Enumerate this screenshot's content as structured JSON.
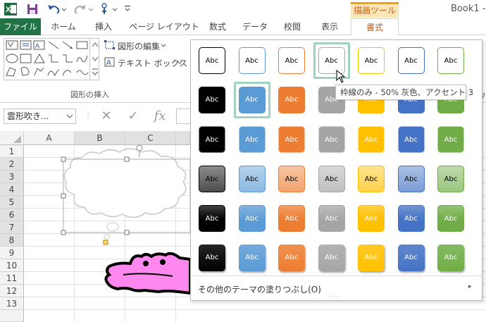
{
  "app": {
    "title": "Book1 -",
    "context_tab": "描画ツール"
  },
  "tabs": [
    "ファイル",
    "ホーム",
    "挿入",
    "ページ レイアウト",
    "数式",
    "データ",
    "校閲",
    "表示",
    "書式"
  ],
  "ribbon": {
    "edit_shape_label": "図形の編集",
    "text_box_label": "テキスト ボックス",
    "group_label": "図形の挿入",
    "right_clip": "フ"
  },
  "formula_bar": {
    "name_box": "雲形吹き...",
    "fx_label": "fx"
  },
  "grid": {
    "columns": [
      "A",
      "B",
      "C"
    ],
    "rows": [
      "1",
      "2",
      "3",
      "4",
      "5",
      "6",
      "7",
      "8",
      "9",
      "10",
      "11",
      "12",
      "13"
    ]
  },
  "style_gallery": {
    "swatch_label": "Abc",
    "selected_row": 1,
    "selected_col": 1,
    "hover_row": 0,
    "hover_col": 3,
    "accent_colors": [
      "#000000",
      "#5b9bd5",
      "#ed7d31",
      "#a5a5a5",
      "#ffc000",
      "#4472c4",
      "#70ad47"
    ],
    "more_fills_label": "その他のテーマの塗りつぶし(O)",
    "tooltip": "枠線のみ - 50% 灰色、アクセント 3"
  },
  "shape": {
    "fill_color": "#ff88ee",
    "outline_color": "#000000"
  }
}
